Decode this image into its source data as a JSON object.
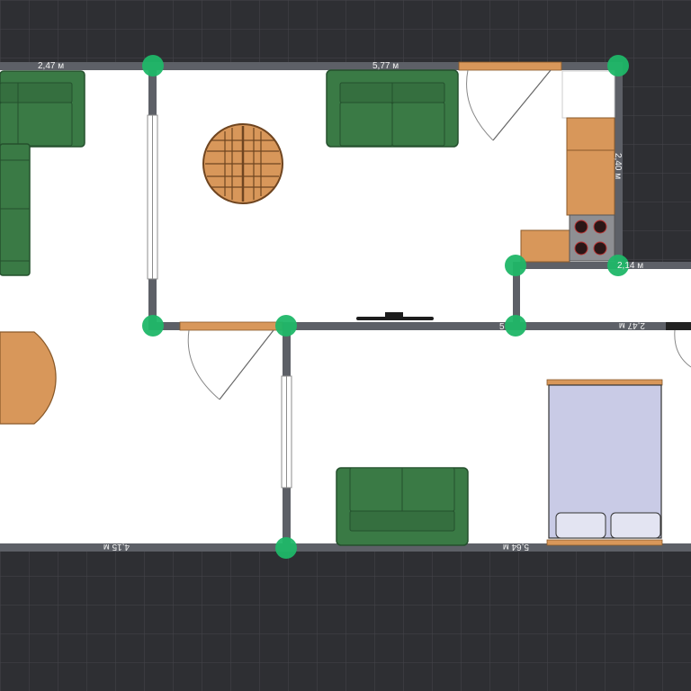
{
  "app": {
    "view": "floor-plan"
  },
  "colors": {
    "grid_bg": "#2e2f33",
    "grid_line": "#45464b",
    "floor": "#ffffff",
    "wall": "#5d6067",
    "node": "#1fb768",
    "sofa": "#3a7a45",
    "sofa_edge": "#24502d",
    "wood": "#d8975a",
    "bed_sheet": "#c9cbe6",
    "stove": "#8e8f93"
  },
  "dimensions": {
    "top_left": "2,47 м",
    "top_mid": "5,77 м",
    "right_top": "2,40 м",
    "right_small": "2,14 м",
    "mid_wall": "5",
    "right_mid": "2,47 м",
    "bottom_left": "4,15 м",
    "bottom_right": "5,64 м"
  },
  "icons": {
    "node": "wall-junction-node",
    "door": "door-swing",
    "window": "window",
    "tv": "tv-icon"
  }
}
